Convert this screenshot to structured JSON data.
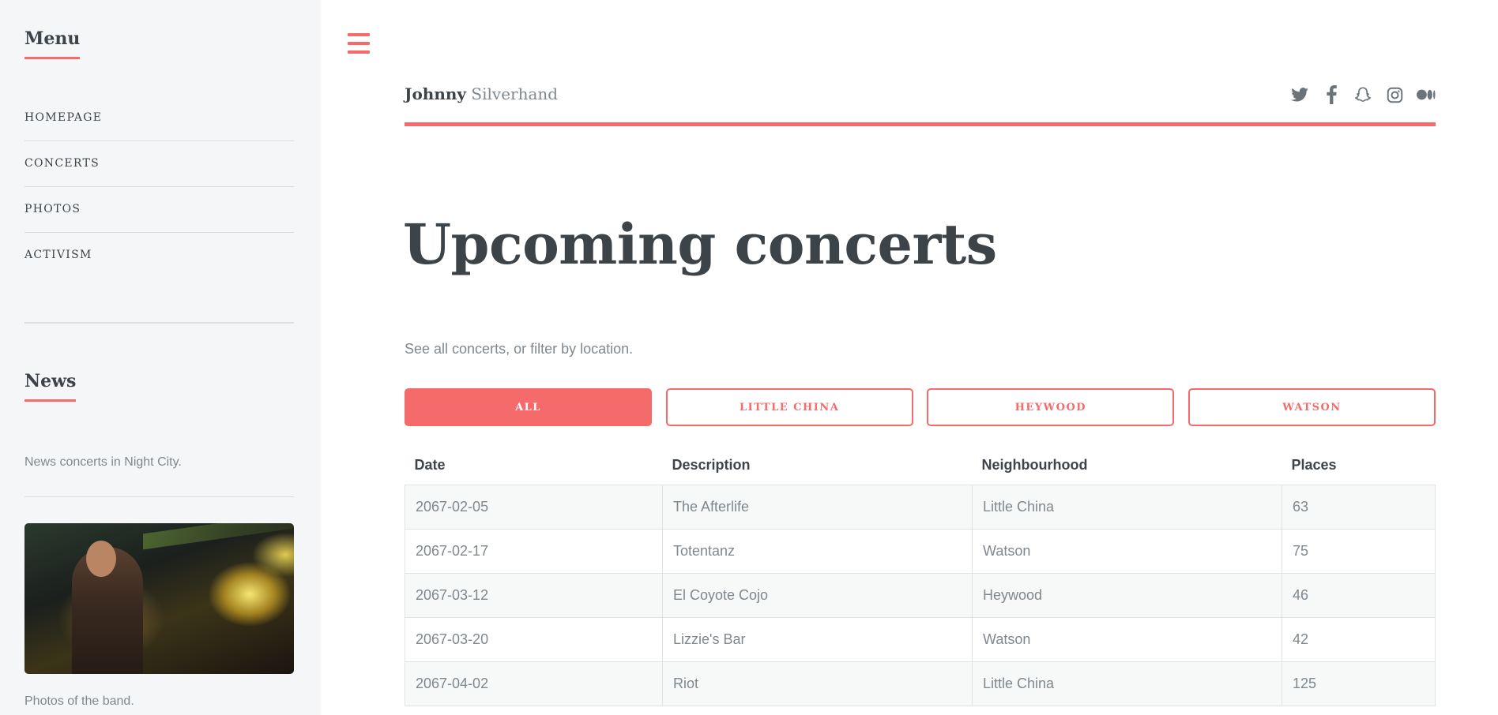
{
  "sidebar": {
    "menu_title": "Menu",
    "menu_items": [
      {
        "label": "HOMEPAGE"
      },
      {
        "label": "CONCERTS"
      },
      {
        "label": "PHOTOS"
      },
      {
        "label": "ACTIVISM"
      }
    ],
    "news_title": "News",
    "news_text": "News concerts in Night City.",
    "news_caption": "Photos of the band."
  },
  "header": {
    "first_name": "Johnny",
    "last_name": "Silverhand",
    "social_icons": [
      "twitter-icon",
      "facebook-icon",
      "snapchat-icon",
      "instagram-icon",
      "medium-icon"
    ]
  },
  "main": {
    "title": "Upcoming concerts",
    "intro": "See all concerts, or filter by location.",
    "filters": [
      {
        "label": "ALL",
        "active": true
      },
      {
        "label": "LITTLE CHINA",
        "active": false
      },
      {
        "label": "HEYWOOD",
        "active": false
      },
      {
        "label": "WATSON",
        "active": false
      }
    ],
    "table": {
      "headers": [
        "Date",
        "Description",
        "Neighbourhood",
        "Places"
      ],
      "rows": [
        [
          "2067-02-05",
          "The Afterlife",
          "Little China",
          "63"
        ],
        [
          "2067-02-17",
          "Totentanz",
          "Watson",
          "75"
        ],
        [
          "2067-03-12",
          "El Coyote Cojo",
          "Heywood",
          "46"
        ],
        [
          "2067-03-20",
          "Lizzie's Bar",
          "Watson",
          "42"
        ],
        [
          "2067-04-02",
          "Riot",
          "Little China",
          "125"
        ]
      ]
    }
  },
  "colors": {
    "accent": "#f56a6a",
    "text": "#3d4449",
    "muted": "#7f888f",
    "sidebar_bg": "#f5f6f7"
  }
}
